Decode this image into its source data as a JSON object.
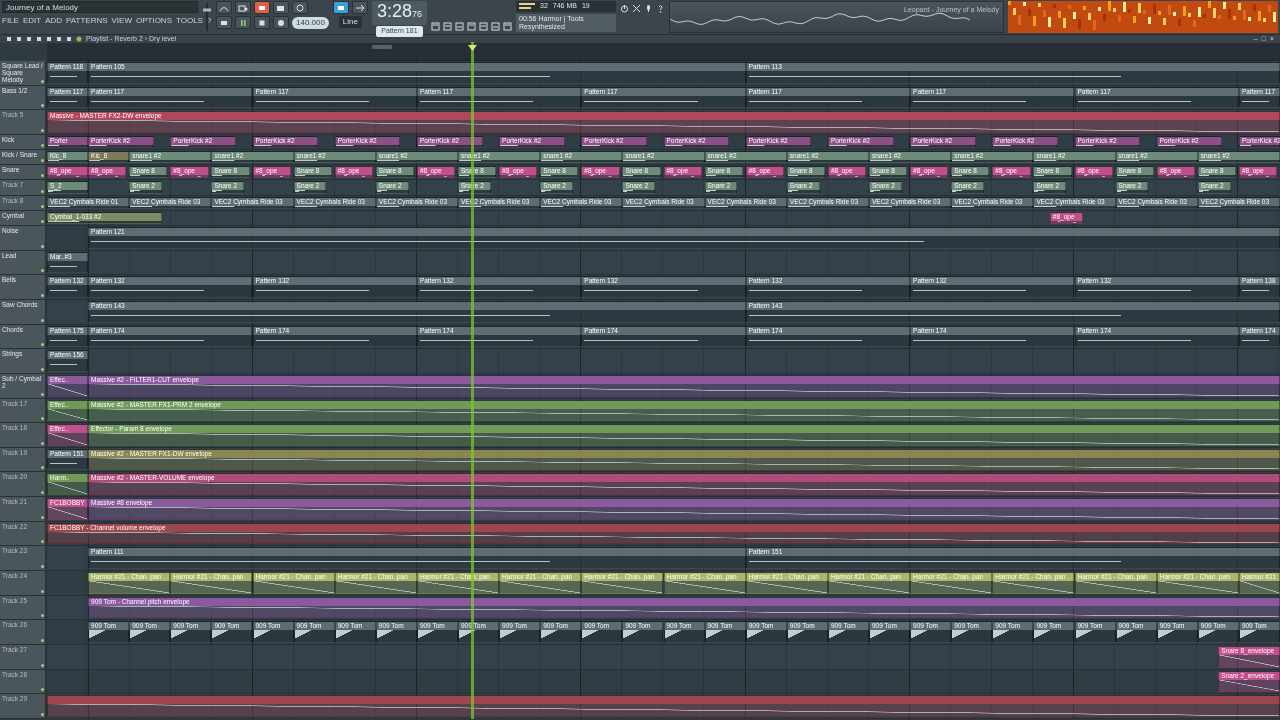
{
  "window": {
    "title": "Journey of a Melody"
  },
  "menu": [
    "FILE",
    "EDIT",
    "ADD",
    "PATTERNS",
    "VIEW",
    "OPTIONS",
    "TOOLS",
    "?"
  ],
  "master_volume": {
    "level": 0.78
  },
  "transport": {
    "playing": true,
    "tempo": "140.000"
  },
  "time": {
    "main": "3:28",
    "sub": "76"
  },
  "pattern": "Pattern 181",
  "snap": "Line",
  "hint": {
    "line1": "00:56 Harmor | Tools",
    "line2": "Resynthesized"
  },
  "monitor": {
    "memory": "746 MB",
    "value_1": "32",
    "value_2": "19"
  },
  "oscilloscope": {
    "caption": "Leopard - Journey of a Melody"
  },
  "playlist": {
    "title": "Playlist - Reverb 2 › Dry level"
  },
  "window_controls": [
    "–",
    "□",
    "×"
  ],
  "playhead": {
    "level": 0.344
  },
  "tracks": [
    {
      "name": "Square Lead / Square Melody",
      "dim": false,
      "compact": false,
      "clips": [
        {
          "label": "Pattern 118",
          "kind": "pattern",
          "color": "#5e6c74"
        },
        {
          "label": "Pattern 105",
          "kind": "pattern",
          "color": "#5e6c74"
        },
        {
          "label": "Pattern 113",
          "kind": "pattern",
          "color": "#5e6c74"
        }
      ]
    },
    {
      "name": "Bass 1/2",
      "dim": false,
      "compact": false,
      "clips": [
        {
          "label": "Pattern 117",
          "kind": "pattern",
          "color": "#5e6c74"
        },
        {
          "label": "Pattern 117",
          "kind": "pattern",
          "color": "#5e6c74"
        },
        {
          "label": "Pattern 117",
          "kind": "pattern",
          "color": "#5e6c74"
        },
        {
          "label": "Pattern 117",
          "kind": "pattern",
          "color": "#5e6c74"
        },
        {
          "label": "Pattern 117",
          "kind": "pattern",
          "color": "#5e6c74"
        },
        {
          "label": "Pattern 117",
          "kind": "pattern",
          "color": "#5e6c74"
        },
        {
          "label": "Pattern 117",
          "kind": "pattern",
          "color": "#5e6c74"
        },
        {
          "label": "Pattern 117",
          "kind": "pattern",
          "color": "#5e6c74"
        },
        {
          "label": "Pattern 117",
          "kind": "pattern",
          "color": "#5e6c74"
        }
      ]
    },
    {
      "name": "Track 5",
      "dim": true,
      "compact": false,
      "clips": [
        {
          "label": "Massive - MASTER FX2-DW envelope",
          "kind": "automation",
          "color": "#b0485c"
        }
      ]
    },
    {
      "name": "Kick",
      "dim": false,
      "compact": true,
      "clips": [
        {
          "label": "Porter",
          "kind": "audio",
          "color": "#8c4f86"
        },
        {
          "label": "PorterKick #2",
          "kind": "audio",
          "color": "#8c4f86"
        },
        {
          "label": "PorterKick #2",
          "kind": "audio",
          "color": "#8c4f86"
        },
        {
          "label": "PorterKick #2",
          "kind": "audio",
          "color": "#8c4f86"
        },
        {
          "label": "PorterKick #2",
          "kind": "audio",
          "color": "#8c4f86"
        },
        {
          "label": "PorterKick #2",
          "kind": "audio",
          "color": "#8c4f86"
        },
        {
          "label": "PorterKick #2",
          "kind": "audio",
          "color": "#8c4f86"
        },
        {
          "label": "PorterKick #2",
          "kind": "audio",
          "color": "#8c4f86"
        },
        {
          "label": "PorterKick #2",
          "kind": "audio",
          "color": "#8c4f86"
        },
        {
          "label": "PorterKick #2",
          "kind": "audio",
          "color": "#8c4f86"
        },
        {
          "label": "PorterKick #2",
          "kind": "audio",
          "color": "#8c4f86"
        },
        {
          "label": "PorterKick #2",
          "kind": "audio",
          "color": "#8c4f86"
        },
        {
          "label": "PorterKick #2",
          "kind": "audio",
          "color": "#8c4f86"
        },
        {
          "label": "PorterKick #2",
          "kind": "audio",
          "color": "#8c4f86"
        },
        {
          "label": "PorterKick #2",
          "kind": "audio",
          "color": "#8c4f86"
        },
        {
          "label": "PorterKick #2",
          "kind": "audio",
          "color": "#8c4f86"
        }
      ]
    },
    {
      "name": "Kick / Snare",
      "dim": false,
      "compact": true,
      "clips": [
        {
          "label": "Kic_8",
          "kind": "audio",
          "color": "#6e8a78"
        },
        {
          "label": "Kic_8",
          "kind": "audio",
          "color": "#7e7a58"
        },
        {
          "label": "snare1 #2",
          "kind": "audio",
          "color": "#6e8a78"
        },
        {
          "label": "snare1 #2",
          "kind": "audio",
          "color": "#6e8a78"
        },
        {
          "label": "snare1 #2",
          "kind": "audio",
          "color": "#6e8a78"
        },
        {
          "label": "snare1 #2",
          "kind": "audio",
          "color": "#6e8a78"
        },
        {
          "label": "snare1 #2",
          "kind": "audio",
          "color": "#6e8a78"
        },
        {
          "label": "snare1 #2",
          "kind": "audio",
          "color": "#6e8a78"
        },
        {
          "label": "snare1 #2",
          "kind": "audio",
          "color": "#6e8a78"
        },
        {
          "label": "snare1 #2",
          "kind": "audio",
          "color": "#6e8a78"
        },
        {
          "label": "snare1 #2",
          "kind": "audio",
          "color": "#6e8a78"
        },
        {
          "label": "snare1 #2",
          "kind": "audio",
          "color": "#6e8a78"
        },
        {
          "label": "snare1 #2",
          "kind": "audio",
          "color": "#6e8a78"
        },
        {
          "label": "snare1 #2",
          "kind": "audio",
          "color": "#6e8a78"
        },
        {
          "label": "snare1 #2",
          "kind": "audio",
          "color": "#6e8a78"
        },
        {
          "label": "snare1 #2",
          "kind": "audio",
          "color": "#6e8a78"
        }
      ]
    },
    {
      "name": "Snare",
      "dim": false,
      "compact": true,
      "clips": [
        {
          "label": "#8_ope",
          "kind": "automation",
          "color": "#c0508c"
        },
        {
          "label": "#8_ope",
          "kind": "automation",
          "color": "#c0508c"
        },
        {
          "label": "Snare 8",
          "kind": "audio",
          "color": "#6e8a78"
        },
        {
          "label": "#8_ope",
          "kind": "automation",
          "color": "#c0508c"
        },
        {
          "label": "Snare 8",
          "kind": "audio",
          "color": "#6e8a78"
        },
        {
          "label": "#8_ope",
          "kind": "automation",
          "color": "#c0508c"
        },
        {
          "label": "Snare 8",
          "kind": "audio",
          "color": "#6e8a78"
        },
        {
          "label": "#8_ope",
          "kind": "automation",
          "color": "#c0508c"
        },
        {
          "label": "Snare 8",
          "kind": "audio",
          "color": "#6e8a78"
        },
        {
          "label": "#8_ope",
          "kind": "automation",
          "color": "#c0508c"
        },
        {
          "label": "Snare 8",
          "kind": "audio",
          "color": "#6e8a78"
        },
        {
          "label": "#8_ope",
          "kind": "automation",
          "color": "#c0508c"
        },
        {
          "label": "Snare 8",
          "kind": "audio",
          "color": "#6e8a78"
        },
        {
          "label": "#8_ope",
          "kind": "automation",
          "color": "#c0508c"
        },
        {
          "label": "Snare 8",
          "kind": "audio",
          "color": "#6e8a78"
        },
        {
          "label": "#8_ope",
          "kind": "automation",
          "color": "#c0508c"
        },
        {
          "label": "Snare 8",
          "kind": "audio",
          "color": "#6e8a78"
        },
        {
          "label": "#8_ope",
          "kind": "automation",
          "color": "#c0508c"
        },
        {
          "label": "Snare 8",
          "kind": "audio",
          "color": "#6e8a78"
        },
        {
          "label": "#8_ope",
          "kind": "automation",
          "color": "#c0508c"
        },
        {
          "label": "Snare 8",
          "kind": "audio",
          "color": "#6e8a78"
        },
        {
          "label": "#8_ope",
          "kind": "automation",
          "color": "#c0508c"
        },
        {
          "label": "Snare 8",
          "kind": "audio",
          "color": "#6e8a78"
        },
        {
          "label": "#8_ope",
          "kind": "automation",
          "color": "#c0508c"
        },
        {
          "label": "Snare 8",
          "kind": "audio",
          "color": "#6e8a78"
        },
        {
          "label": "#8_ope",
          "kind": "automation",
          "color": "#c0508c"
        },
        {
          "label": "Snare 8",
          "kind": "audio",
          "color": "#6e8a78"
        },
        {
          "label": "#8_ope",
          "kind": "automation",
          "color": "#c0508c"
        },
        {
          "label": "Snare 8",
          "kind": "audio",
          "color": "#6e8a78"
        },
        {
          "label": "#8_ope",
          "kind": "automation",
          "color": "#c0508c"
        }
      ]
    },
    {
      "name": "Track 7",
      "dim": true,
      "compact": true,
      "clips": [
        {
          "label": "S_2",
          "kind": "audio",
          "color": "#6e8a78"
        },
        {
          "label": "Snare 2",
          "kind": "audio",
          "color": "#6e8a78"
        },
        {
          "label": "Snare 2",
          "kind": "audio",
          "color": "#6e8a78"
        },
        {
          "label": "Snare 2",
          "kind": "audio",
          "color": "#6e8a78"
        },
        {
          "label": "Snare 2",
          "kind": "audio",
          "color": "#6e8a78"
        },
        {
          "label": "Snare 2",
          "kind": "audio",
          "color": "#6e8a78"
        },
        {
          "label": "Snare 2",
          "kind": "audio",
          "color": "#6e8a78"
        },
        {
          "label": "Snare 2",
          "kind": "audio",
          "color": "#6e8a78"
        },
        {
          "label": "Snare 2",
          "kind": "audio",
          "color": "#6e8a78"
        },
        {
          "label": "Snare 2",
          "kind": "audio",
          "color": "#6e8a78"
        },
        {
          "label": "Snare 2",
          "kind": "audio",
          "color": "#6e8a78"
        },
        {
          "label": "Snare 2",
          "kind": "audio",
          "color": "#6e8a78"
        },
        {
          "label": "Snare 2",
          "kind": "audio",
          "color": "#6e8a78"
        },
        {
          "label": "Snare 2",
          "kind": "audio",
          "color": "#6e8a78"
        },
        {
          "label": "Snare 2",
          "kind": "audio",
          "color": "#6e8a78"
        }
      ]
    },
    {
      "name": "Track 8",
      "dim": true,
      "compact": true,
      "clips": [
        {
          "label": "VEC2 Cymbals Ride 01",
          "kind": "audio",
          "color": "#5e6c74"
        },
        {
          "label": "VEC2 Cymbals Ride 03",
          "kind": "audio",
          "color": "#5e6c74"
        },
        {
          "label": "VEC2 Cymbals Ride 03",
          "kind": "audio",
          "color": "#5e6c74"
        },
        {
          "label": "VEC2 Cymbals Ride 03",
          "kind": "audio",
          "color": "#5e6c74"
        },
        {
          "label": "VEC2 Cymbals Ride 03",
          "kind": "audio",
          "color": "#5e6c74"
        },
        {
          "label": "VEC2 Cymbals Ride 03",
          "kind": "audio",
          "color": "#5e6c74"
        },
        {
          "label": "VEC2 Cymbals Ride 03",
          "kind": "audio",
          "color": "#5e6c74"
        },
        {
          "label": "VEC2 Cymbals Ride 03",
          "kind": "audio",
          "color": "#5e6c74"
        },
        {
          "label": "VEC2 Cymbals Ride 03",
          "kind": "audio",
          "color": "#5e6c74"
        },
        {
          "label": "VEC2 Cymbals Ride 03",
          "kind": "audio",
          "color": "#5e6c74"
        },
        {
          "label": "VEC2 Cymbals Ride 03",
          "kind": "audio",
          "color": "#5e6c74"
        },
        {
          "label": "VEC2 Cymbals Ride 03",
          "kind": "audio",
          "color": "#5e6c74"
        },
        {
          "label": "VEC2 Cymbals Ride 03",
          "kind": "audio",
          "color": "#5e6c74"
        },
        {
          "label": "VEC2 Cymbals Ride 03",
          "kind": "audio",
          "color": "#5e6c74"
        },
        {
          "label": "VEC2 Cymbals Ride 03",
          "kind": "audio",
          "color": "#5e6c74"
        }
      ]
    },
    {
      "name": "Cymbal",
      "dim": false,
      "compact": true,
      "clips": [
        {
          "label": "Cymbal_1-033 #2",
          "kind": "audio",
          "color": "#7e8a64"
        },
        {
          "label": "#8_ope",
          "kind": "automation",
          "color": "#c0508c"
        }
      ]
    },
    {
      "name": "Noise",
      "dim": false,
      "compact": false,
      "clips": [
        {
          "label": "Pattern 121",
          "kind": "pattern",
          "color": "#5e6c74"
        }
      ]
    },
    {
      "name": "Lead",
      "dim": false,
      "compact": false,
      "clips": [
        {
          "label": "Mar..#3",
          "kind": "pattern",
          "color": "#5e6c74"
        }
      ]
    },
    {
      "name": "Bells",
      "dim": false,
      "compact": false,
      "clips": [
        {
          "label": "Pattern 132",
          "kind": "pattern",
          "color": "#5e6c74"
        },
        {
          "label": "Pattern 132",
          "kind": "pattern",
          "color": "#5e6c74"
        },
        {
          "label": "Pattern 132",
          "kind": "pattern",
          "color": "#5e6c74"
        },
        {
          "label": "Pattern 132",
          "kind": "pattern",
          "color": "#5e6c74"
        },
        {
          "label": "Pattern 132",
          "kind": "pattern",
          "color": "#5e6c74"
        },
        {
          "label": "Pattern 132",
          "kind": "pattern",
          "color": "#5e6c74"
        },
        {
          "label": "Pattern 132",
          "kind": "pattern",
          "color": "#5e6c74"
        },
        {
          "label": "Pattern 132",
          "kind": "pattern",
          "color": "#5e6c74"
        },
        {
          "label": "Pattern 138",
          "kind": "pattern",
          "color": "#5e6c74"
        }
      ]
    },
    {
      "name": "Saw Chords",
      "dim": false,
      "compact": false,
      "clips": [
        {
          "label": "Pattern 143",
          "kind": "pattern",
          "color": "#5e6c74"
        },
        {
          "label": "Pattern 143",
          "kind": "pattern",
          "color": "#5e6c74"
        }
      ]
    },
    {
      "name": "Chords",
      "dim": false,
      "compact": false,
      "clips": [
        {
          "label": "Pattern 175",
          "kind": "pattern",
          "color": "#5e6c74"
        },
        {
          "label": "Pattern 174",
          "kind": "pattern",
          "color": "#5e6c74"
        },
        {
          "label": "Pattern 174",
          "kind": "pattern",
          "color": "#5e6c74"
        },
        {
          "label": "Pattern 174",
          "kind": "pattern",
          "color": "#5e6c74"
        },
        {
          "label": "Pattern 174",
          "kind": "pattern",
          "color": "#5e6c74"
        },
        {
          "label": "Pattern 174",
          "kind": "pattern",
          "color": "#5e6c74"
        },
        {
          "label": "Pattern 174",
          "kind": "pattern",
          "color": "#5e6c74"
        },
        {
          "label": "Pattern 174",
          "kind": "pattern",
          "color": "#5e6c74"
        },
        {
          "label": "Pattern 174",
          "kind": "pattern",
          "color": "#5e6c74"
        }
      ]
    },
    {
      "name": "Strings",
      "dim": false,
      "compact": false,
      "clips": [
        {
          "label": "Pattern 156",
          "kind": "pattern",
          "color": "#5e6c74"
        }
      ]
    },
    {
      "name": "Sub / Cymbal 2",
      "dim": false,
      "compact": false,
      "clips": [
        {
          "label": "Effec..",
          "kind": "automation",
          "color": "#8b5a9c"
        },
        {
          "label": "Massive #2 - FILTER1-CUT envelope",
          "kind": "automation",
          "color": "#8b5a9c"
        }
      ]
    },
    {
      "name": "Track 17",
      "dim": true,
      "compact": false,
      "clips": [
        {
          "label": "Effec..",
          "kind": "automation",
          "color": "#6f9a58"
        },
        {
          "label": "Massive #2 - MASTER FX1-PRM 2 envelope",
          "kind": "automation",
          "color": "#6f9a58"
        }
      ]
    },
    {
      "name": "Track 18",
      "dim": true,
      "compact": false,
      "clips": [
        {
          "label": "Effec..",
          "kind": "automation",
          "color": "#c0508c"
        },
        {
          "label": "Effector - Param 8 envelope",
          "kind": "automation",
          "color": "#6f9a58"
        }
      ]
    },
    {
      "name": "Track 19",
      "dim": true,
      "compact": false,
      "clips": [
        {
          "label": "Pattern 151",
          "kind": "pattern",
          "color": "#5e6c74"
        },
        {
          "label": "Massive #2 - MASTER FX1-DW envelope",
          "kind": "automation",
          "color": "#8a8652"
        }
      ]
    },
    {
      "name": "Track 20",
      "dim": true,
      "compact": false,
      "clips": [
        {
          "label": "Harm..",
          "kind": "automation",
          "color": "#6f9a58"
        },
        {
          "label": "Massive #2 - MASTER-VOLUME envelope",
          "kind": "automation",
          "color": "#b04c78"
        }
      ]
    },
    {
      "name": "Track 21",
      "dim": true,
      "compact": false,
      "clips": [
        {
          "label": "FC1BOBBY",
          "kind": "automation",
          "color": "#c0508c"
        },
        {
          "label": "Massive #8 envelope",
          "kind": "automation",
          "color": "#8b5a9c"
        }
      ]
    },
    {
      "name": "Track 22",
      "dim": true,
      "compact": false,
      "clips": [
        {
          "label": "FC1BOBBY - Channel volume envelope",
          "kind": "automation",
          "color": "#9c4650"
        }
      ]
    },
    {
      "name": "Track 23",
      "dim": true,
      "compact": false,
      "clips": [
        {
          "label": "Pattern 111",
          "kind": "pattern",
          "color": "#5e6c74"
        },
        {
          "label": "Pattern 151",
          "kind": "pattern",
          "color": "#5e6c74"
        }
      ]
    },
    {
      "name": "Track 24",
      "dim": true,
      "compact": false,
      "clips": [
        {
          "label": "Harmor #21 - Chan. pan",
          "kind": "automation",
          "color": "#a9b86c"
        },
        {
          "label": "Harmor #21 - Chan. pan",
          "kind": "automation",
          "color": "#a9b86c"
        },
        {
          "label": "Harmor #21 - Chan. pan",
          "kind": "automation",
          "color": "#a9b86c"
        },
        {
          "label": "Harmor #21 - Chan. pan",
          "kind": "automation",
          "color": "#a9b86c"
        },
        {
          "label": "Harmor #21 - Chan. pan",
          "kind": "automation",
          "color": "#a9b86c"
        },
        {
          "label": "Harmor #21 - Chan. pan",
          "kind": "automation",
          "color": "#a9b86c"
        },
        {
          "label": "Harmor #21 - Chan. pan",
          "kind": "automation",
          "color": "#a9b86c"
        },
        {
          "label": "Harmor #21 - Chan. pan",
          "kind": "automation",
          "color": "#a9b86c"
        },
        {
          "label": "Harmor #21 - Chan. pan",
          "kind": "automation",
          "color": "#a9b86c"
        },
        {
          "label": "Harmor #21 - Chan. pan",
          "kind": "automation",
          "color": "#a9b86c"
        },
        {
          "label": "Harmor #21 - Chan. pan",
          "kind": "automation",
          "color": "#a9b86c"
        },
        {
          "label": "Harmor #21 - Chan. pan",
          "kind": "automation",
          "color": "#a9b86c"
        },
        {
          "label": "Harmor #21 - Chan. pan",
          "kind": "automation",
          "color": "#a9b86c"
        },
        {
          "label": "Harmor #21 - Chan. pan",
          "kind": "automation",
          "color": "#a9b86c"
        },
        {
          "label": "Harmor #21",
          "kind": "automation",
          "color": "#a9b86c"
        }
      ]
    },
    {
      "name": "Track 25",
      "dim": true,
      "compact": false,
      "clips": [
        {
          "label": "909 Tom - Channel pitch envelope",
          "kind": "automation",
          "color": "#8b5a9c"
        }
      ]
    },
    {
      "name": "Track 26",
      "dim": true,
      "compact": false,
      "clips": [
        {
          "label": "909 Tom",
          "kind": "audio",
          "color": "#5e6c74"
        },
        {
          "label": "909 Tom",
          "kind": "audio",
          "color": "#5e6c74"
        },
        {
          "label": "909 Tom",
          "kind": "audio",
          "color": "#5e6c74"
        },
        {
          "label": "909 Tom",
          "kind": "audio",
          "color": "#5e6c74"
        },
        {
          "label": "909 Tom",
          "kind": "audio",
          "color": "#5e6c74"
        },
        {
          "label": "909 Tom",
          "kind": "audio",
          "color": "#5e6c74"
        },
        {
          "label": "909 Tom",
          "kind": "audio",
          "color": "#5e6c74"
        },
        {
          "label": "909 Tom",
          "kind": "audio",
          "color": "#5e6c74"
        },
        {
          "label": "909 Tom",
          "kind": "audio",
          "color": "#5e6c74"
        },
        {
          "label": "909 Tom",
          "kind": "audio",
          "color": "#5e6c74"
        },
        {
          "label": "909 Tom",
          "kind": "audio",
          "color": "#5e6c74"
        },
        {
          "label": "909 Tom",
          "kind": "audio",
          "color": "#5e6c74"
        },
        {
          "label": "909 Tom",
          "kind": "audio",
          "color": "#5e6c74"
        },
        {
          "label": "909 Tom",
          "kind": "audio",
          "color": "#5e6c74"
        },
        {
          "label": "909 Tom",
          "kind": "audio",
          "color": "#5e6c74"
        },
        {
          "label": "909 Tom",
          "kind": "audio",
          "color": "#5e6c74"
        },
        {
          "label": "909 Tom",
          "kind": "audio",
          "color": "#5e6c74"
        },
        {
          "label": "909 Tom",
          "kind": "audio",
          "color": "#5e6c74"
        },
        {
          "label": "909 Tom",
          "kind": "audio",
          "color": "#5e6c74"
        },
        {
          "label": "909 Tom",
          "kind": "audio",
          "color": "#5e6c74"
        },
        {
          "label": "909 Tom",
          "kind": "audio",
          "color": "#5e6c74"
        },
        {
          "label": "909 Tom",
          "kind": "audio",
          "color": "#5e6c74"
        },
        {
          "label": "909 Tom",
          "kind": "audio",
          "color": "#5e6c74"
        },
        {
          "label": "909 Tom",
          "kind": "audio",
          "color": "#5e6c74"
        },
        {
          "label": "909 Tom",
          "kind": "audio",
          "color": "#5e6c74"
        },
        {
          "label": "909 Tom",
          "kind": "audio",
          "color": "#5e6c74"
        },
        {
          "label": "909 Tom",
          "kind": "audio",
          "color": "#5e6c74"
        },
        {
          "label": "909 Tom",
          "kind": "audio",
          "color": "#5e6c74"
        },
        {
          "label": "909 Tom",
          "kind": "audio",
          "color": "#5e6c74"
        }
      ]
    },
    {
      "name": "Track 27",
      "dim": true,
      "compact": false,
      "clips": [
        {
          "label": "Snare 8_envelope",
          "kind": "automation",
          "color": "#c0508c"
        }
      ]
    },
    {
      "name": "Track 28",
      "dim": true,
      "compact": false,
      "clips": [
        {
          "label": "Snare 2_envelope",
          "kind": "automation",
          "color": "#c0508c"
        }
      ]
    },
    {
      "name": "Track 29",
      "dim": true,
      "compact": false,
      "clips": [
        {
          "kind": "automation",
          "color": "#9c4650"
        }
      ]
    }
  ]
}
